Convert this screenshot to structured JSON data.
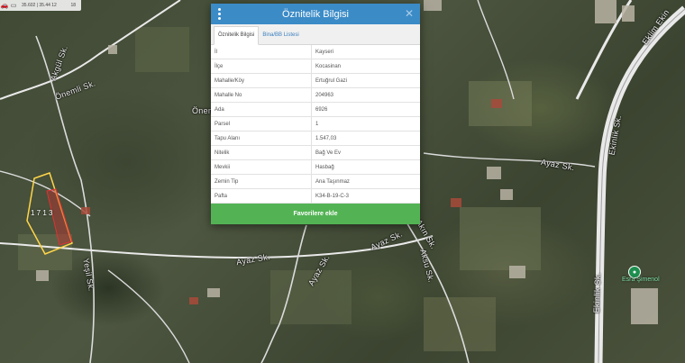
{
  "toolbar": {
    "coords": "35.602 | 35.44 12",
    "zoom": "18"
  },
  "dialog": {
    "title": "Öznitelik Bilgisi",
    "tabs": [
      {
        "label": "Öznitelik Bilgisi",
        "active": true
      },
      {
        "label": "Bina/BB Listesi",
        "active": false
      }
    ],
    "rows": [
      {
        "key": "İl",
        "value": "Kayseri"
      },
      {
        "key": "İlçe",
        "value": "Kocasinan"
      },
      {
        "key": "Mahalle/Köy",
        "value": "Ertuğrul Gazi"
      },
      {
        "key": "Mahalle No",
        "value": "204963"
      },
      {
        "key": "Ada",
        "value": "6926"
      },
      {
        "key": "Parsel",
        "value": "1"
      },
      {
        "key": "Tapu Alanı",
        "value": "1.547,03"
      },
      {
        "key": "Nitelik",
        "value": "Bağ Ve Ev"
      },
      {
        "key": "Mevkii",
        "value": "Hasbağ"
      },
      {
        "key": "Zemin Tip",
        "value": "Ana Taşınmaz"
      },
      {
        "key": "Pafta",
        "value": "K34-B-19-C-3"
      }
    ],
    "favorite_label": "Favorilere ekle"
  },
  "map": {
    "labels": {
      "onemli_1": "Önemli Sk.",
      "onemli_2": "Önem",
      "akgul": "Akgül Sk.",
      "ayaz_1": "Ayaz Sk.",
      "ayaz_2": "Ayaz Sk.",
      "ayaz_3": "Ayaz Sk.",
      "ayaz_4": "Ayaz Sk.",
      "ekinlik_1": "Eklim Ekin",
      "ekinlik_2": "Ekinlik Sk.",
      "ekinlik_3": "Ekinlik Sk.",
      "akinsk": "Akın Sk.",
      "aksu": "Aksu Sk.",
      "yesil": "Yeşil Sk.",
      "parcel": "1 7 1 3",
      "poi": "Esra Şimenol"
    },
    "colors": {
      "parcel_outline": "#ffd54a",
      "parcel_fill": "#c23030",
      "road": "#e9e9e9"
    }
  }
}
